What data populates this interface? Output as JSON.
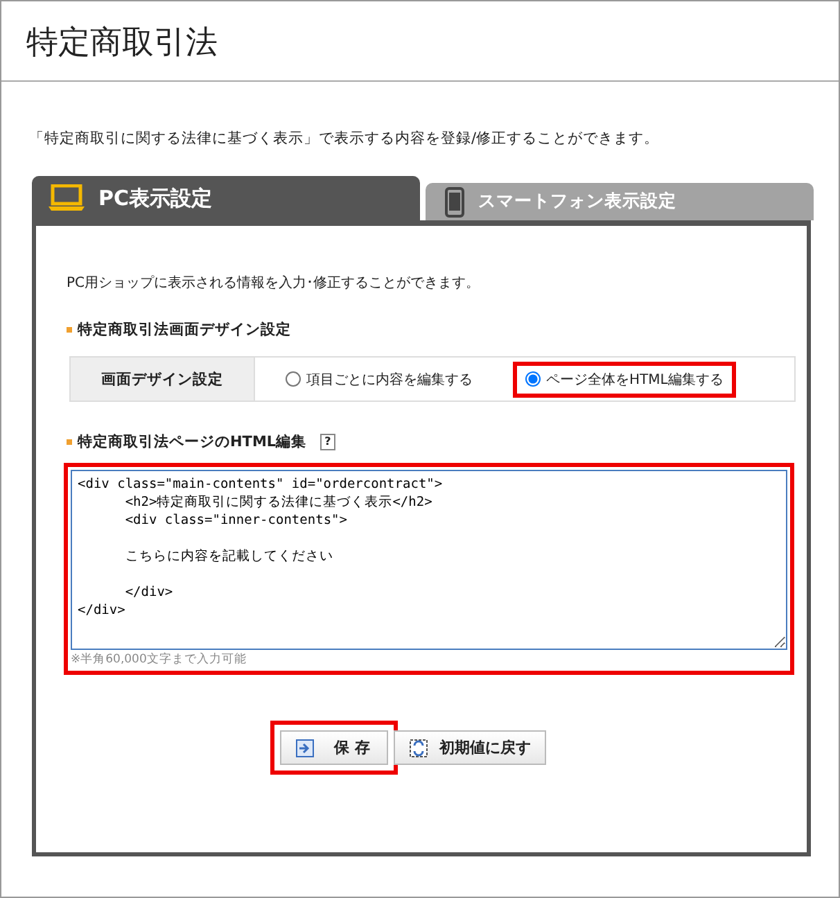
{
  "page_title": "特定商取引法",
  "description": "「特定商取引に関する法律に基づく表示」で表示する内容を登録/修正することができます。",
  "tabs": [
    {
      "label": "PC表示設定",
      "kind": "laptop",
      "selected": true
    },
    {
      "label": "スマートフォン表示設定",
      "kind": "phone",
      "selected": false
    }
  ],
  "intro": "PC用ショップに表示される情報を入力･修正することができます。",
  "design_section": {
    "heading": "特定商取引法画面デザイン設定",
    "row_label": "画面デザイン設定",
    "options": [
      {
        "label": "項目ごとに内容を編集する",
        "selected": false,
        "highlighted": false
      },
      {
        "label": "ページ全体をHTML編集する",
        "selected": true,
        "highlighted": true
      }
    ]
  },
  "html_section": {
    "heading": "特定商取引法ページのHTML編集",
    "help": "?",
    "highlighted": true,
    "value": "<div class=\"main-contents\" id=\"ordercontract\">\n\t<h2>特定商取引に関する法律に基づく表示</h2>\n\t<div class=\"inner-contents\">\n\n\tこちらに内容を記載してください\n\n\t</div>\n</div>",
    "note": "※半角60,000文字まで入力可能"
  },
  "buttons": [
    {
      "label": "保 存",
      "kind": "save",
      "highlighted": true
    },
    {
      "label": "初期値に戻す",
      "kind": "reset",
      "highlighted": false
    }
  ]
}
